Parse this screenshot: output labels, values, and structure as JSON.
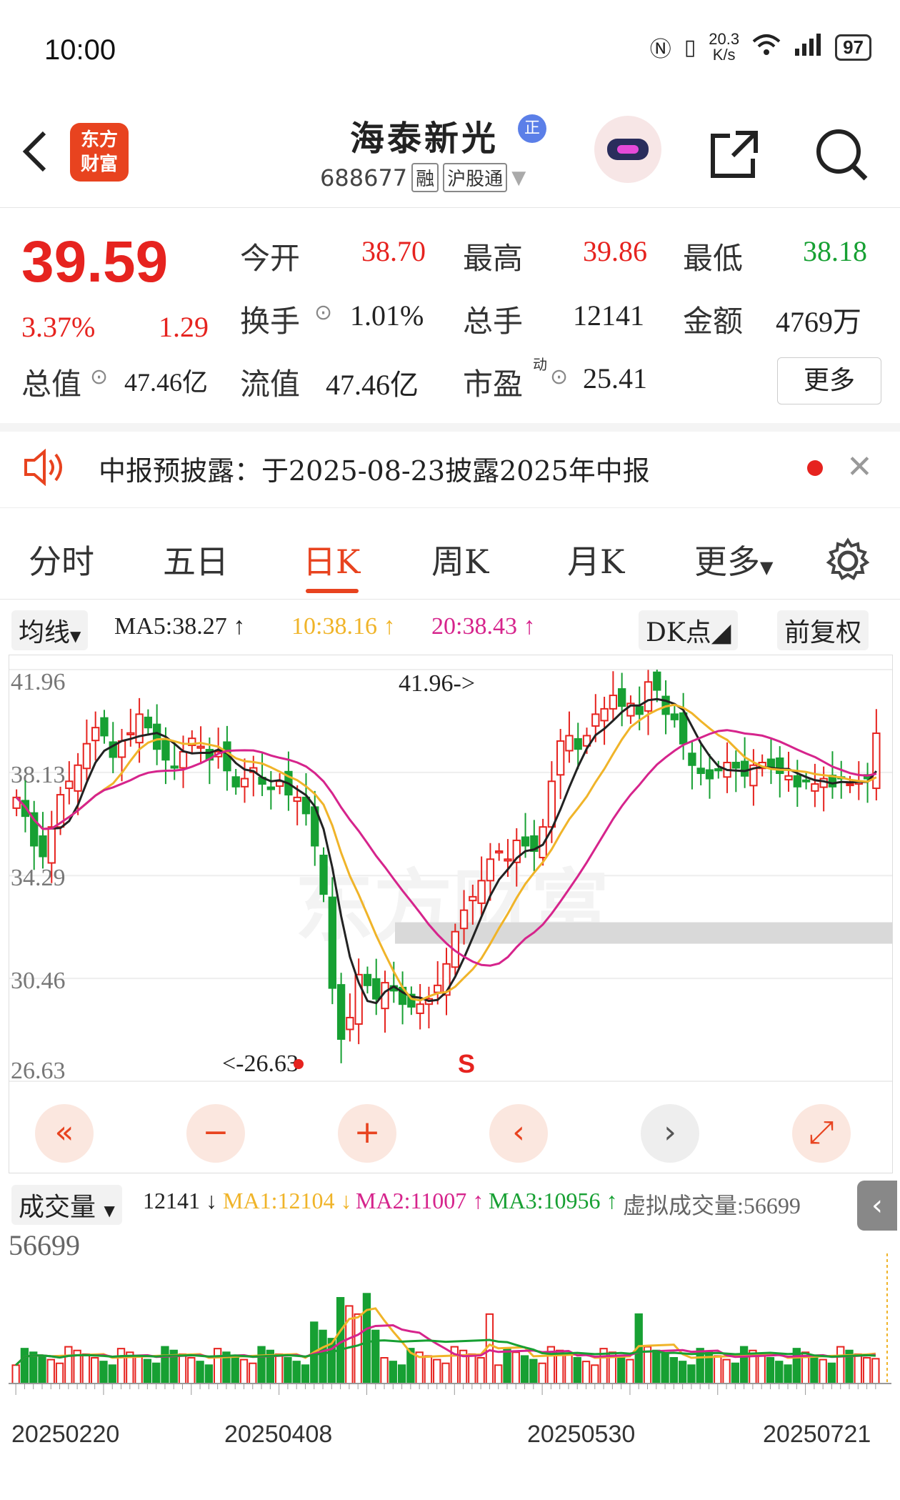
{
  "status": {
    "time": "10:00",
    "speed_value": "20.3",
    "speed_unit": "K/s",
    "battery": "97"
  },
  "header": {
    "app_logo_line1": "东方",
    "app_logo_line2": "财富",
    "stock_name": "海泰新光",
    "name_badge": "正",
    "stock_code": "688677",
    "tag_margin": "融",
    "tag_connect": "沪股通"
  },
  "quote": {
    "price": "39.59",
    "pct_change": "3.37%",
    "abs_change": "1.29",
    "open_label": "今开",
    "open": "38.70",
    "high_label": "最高",
    "high": "39.86",
    "low_label": "最低",
    "low": "38.18",
    "turnover_label": "换手",
    "turnover": "1.01%",
    "volume_label": "总手",
    "volume": "12141",
    "amount_label": "金额",
    "amount": "4769万",
    "mktcap_label": "总值",
    "mktcap": "47.46亿",
    "float_label": "流值",
    "float_cap": "47.46亿",
    "pe_label": "市盈",
    "pe_sup": "动",
    "pe": "25.41",
    "more_label": "更多"
  },
  "notice": {
    "text": "中报预披露：于2025-08-23披露2025年中报"
  },
  "tabs": [
    "分时",
    "五日",
    "日K",
    "周K",
    "月K",
    "更多"
  ],
  "ma_bar": {
    "type_label": "均线",
    "ma5": "MA5:38.27",
    "ma10": "10:38.16",
    "ma20": "20:38.43",
    "dk_label": "DK点",
    "adjust_label": "前复权"
  },
  "chart_data": {
    "type": "candlestick",
    "y_ticks": [
      "41.96",
      "38.13",
      "34.29",
      "30.46",
      "26.63"
    ],
    "ylim": [
      26.63,
      41.96
    ],
    "max_annotation": "41.96->",
    "min_annotation": "<-26.63",
    "sell_marker": "S",
    "x_labels": [
      "20250220",
      "20250408",
      "20250530",
      "20250721"
    ],
    "ma_colors": {
      "ma5": "#222222",
      "ma10": "#f0b429",
      "ma20": "#d6248c"
    },
    "up_color": "#e6231f",
    "down_color": "#17a033",
    "closes": [
      37.2,
      36.5,
      35.4,
      35.0,
      36.1,
      37.3,
      37.8,
      38.4,
      39.2,
      39.8,
      39.5,
      38.7,
      39.3,
      39.6,
      40.3,
      39.8,
      39.0,
      38.6,
      38.3,
      38.9,
      39.4,
      39.1,
      38.6,
      38.9,
      38.2,
      37.6,
      37.9,
      38.3,
      37.7,
      37.5,
      37.8,
      37.3,
      37.2,
      36.6,
      35.4,
      33.6,
      30.1,
      28.2,
      29.0,
      30.6,
      30.2,
      29.7,
      30.3,
      30.0,
      29.5,
      29.4,
      29.5,
      29.7,
      30.2,
      31.0,
      32.2,
      33.0,
      33.5,
      34.1,
      34.9,
      35.2,
      34.9,
      35.6,
      35.4,
      35.2,
      36.1,
      37.8,
      39.3,
      39.5,
      39.0,
      39.5,
      40.3,
      40.5,
      41.0,
      40.6,
      40.7,
      40.3,
      41.5,
      41.2,
      40.3,
      40.1,
      39.2,
      38.4,
      38.1,
      37.9,
      38.2,
      38.5,
      38.3,
      38.0,
      38.4,
      38.5,
      38.3,
      38.1,
      38.0,
      37.6,
      37.8,
      37.7,
      37.9,
      37.6,
      37.9,
      37.7,
      37.8,
      37.9,
      39.59
    ],
    "volume": {
      "max": "56699",
      "value": "12141",
      "ma1": "MA1:12104",
      "ma2": "MA2:11007",
      "ma3": "MA3:10956",
      "virtual": "虚拟成交量:56699"
    },
    "watermark": "东方财富"
  },
  "vol_bar": {
    "label": "成交量"
  }
}
